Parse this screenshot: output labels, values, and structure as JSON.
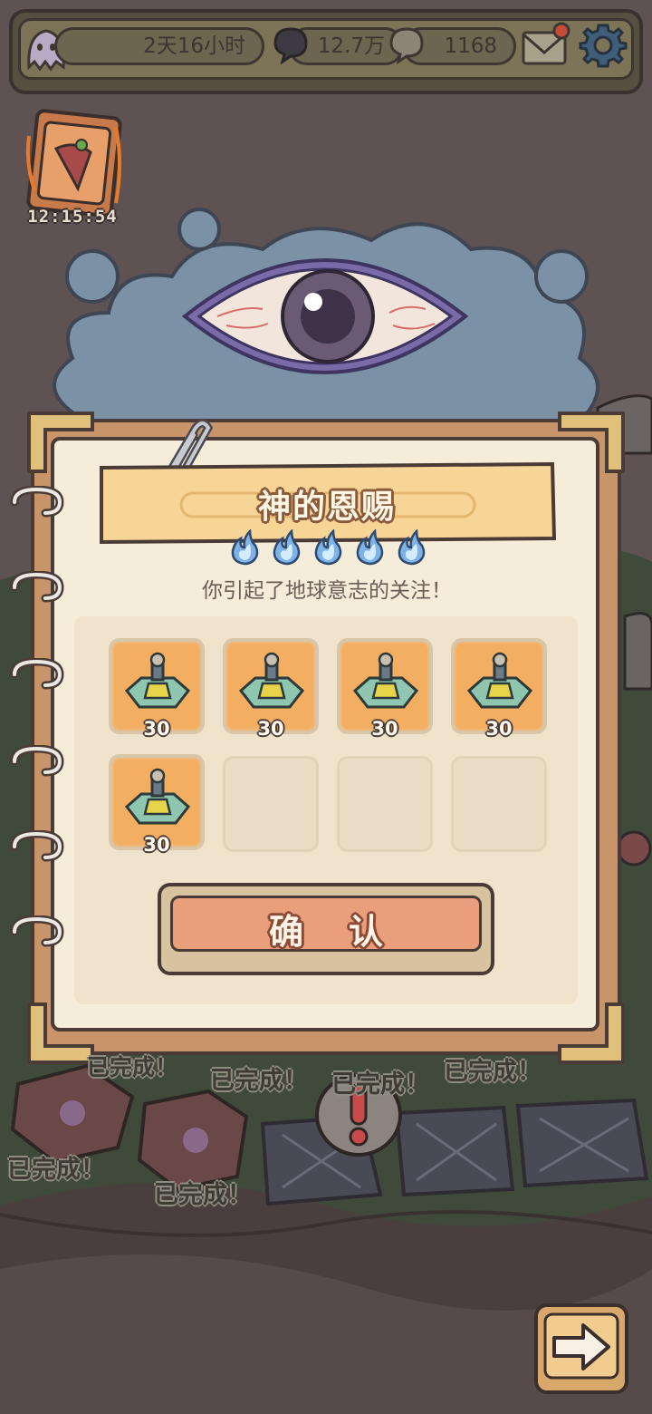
{
  "status_bar": {
    "event_time": "2天16小时",
    "currency_1": "12.7万",
    "currency_2": "1168"
  },
  "event_card": {
    "timer": "12:15:54"
  },
  "dialog": {
    "title": "神的恩赐",
    "stars": 5,
    "subtitle": "你引起了地球意志的关注！",
    "rewards": [
      {
        "icon": "machine-part-icon",
        "qty": "30"
      },
      {
        "icon": "machine-part-icon",
        "qty": "30"
      },
      {
        "icon": "machine-part-icon",
        "qty": "30"
      },
      {
        "icon": "machine-part-icon",
        "qty": "30"
      },
      {
        "icon": "machine-part-icon",
        "qty": "30"
      }
    ],
    "empty_slots": 3,
    "confirm_label": "确认"
  },
  "completed_labels": [
    "已完成！",
    "已完成！",
    "已完成！",
    "已完成！",
    "已完成！",
    "已完成！"
  ],
  "colors": {
    "page": "#f5ecda",
    "slot_filled": "#f4ae62",
    "button": "#e99e7c",
    "flame": "#7fb3e8",
    "cloud": "#7b91a6"
  }
}
